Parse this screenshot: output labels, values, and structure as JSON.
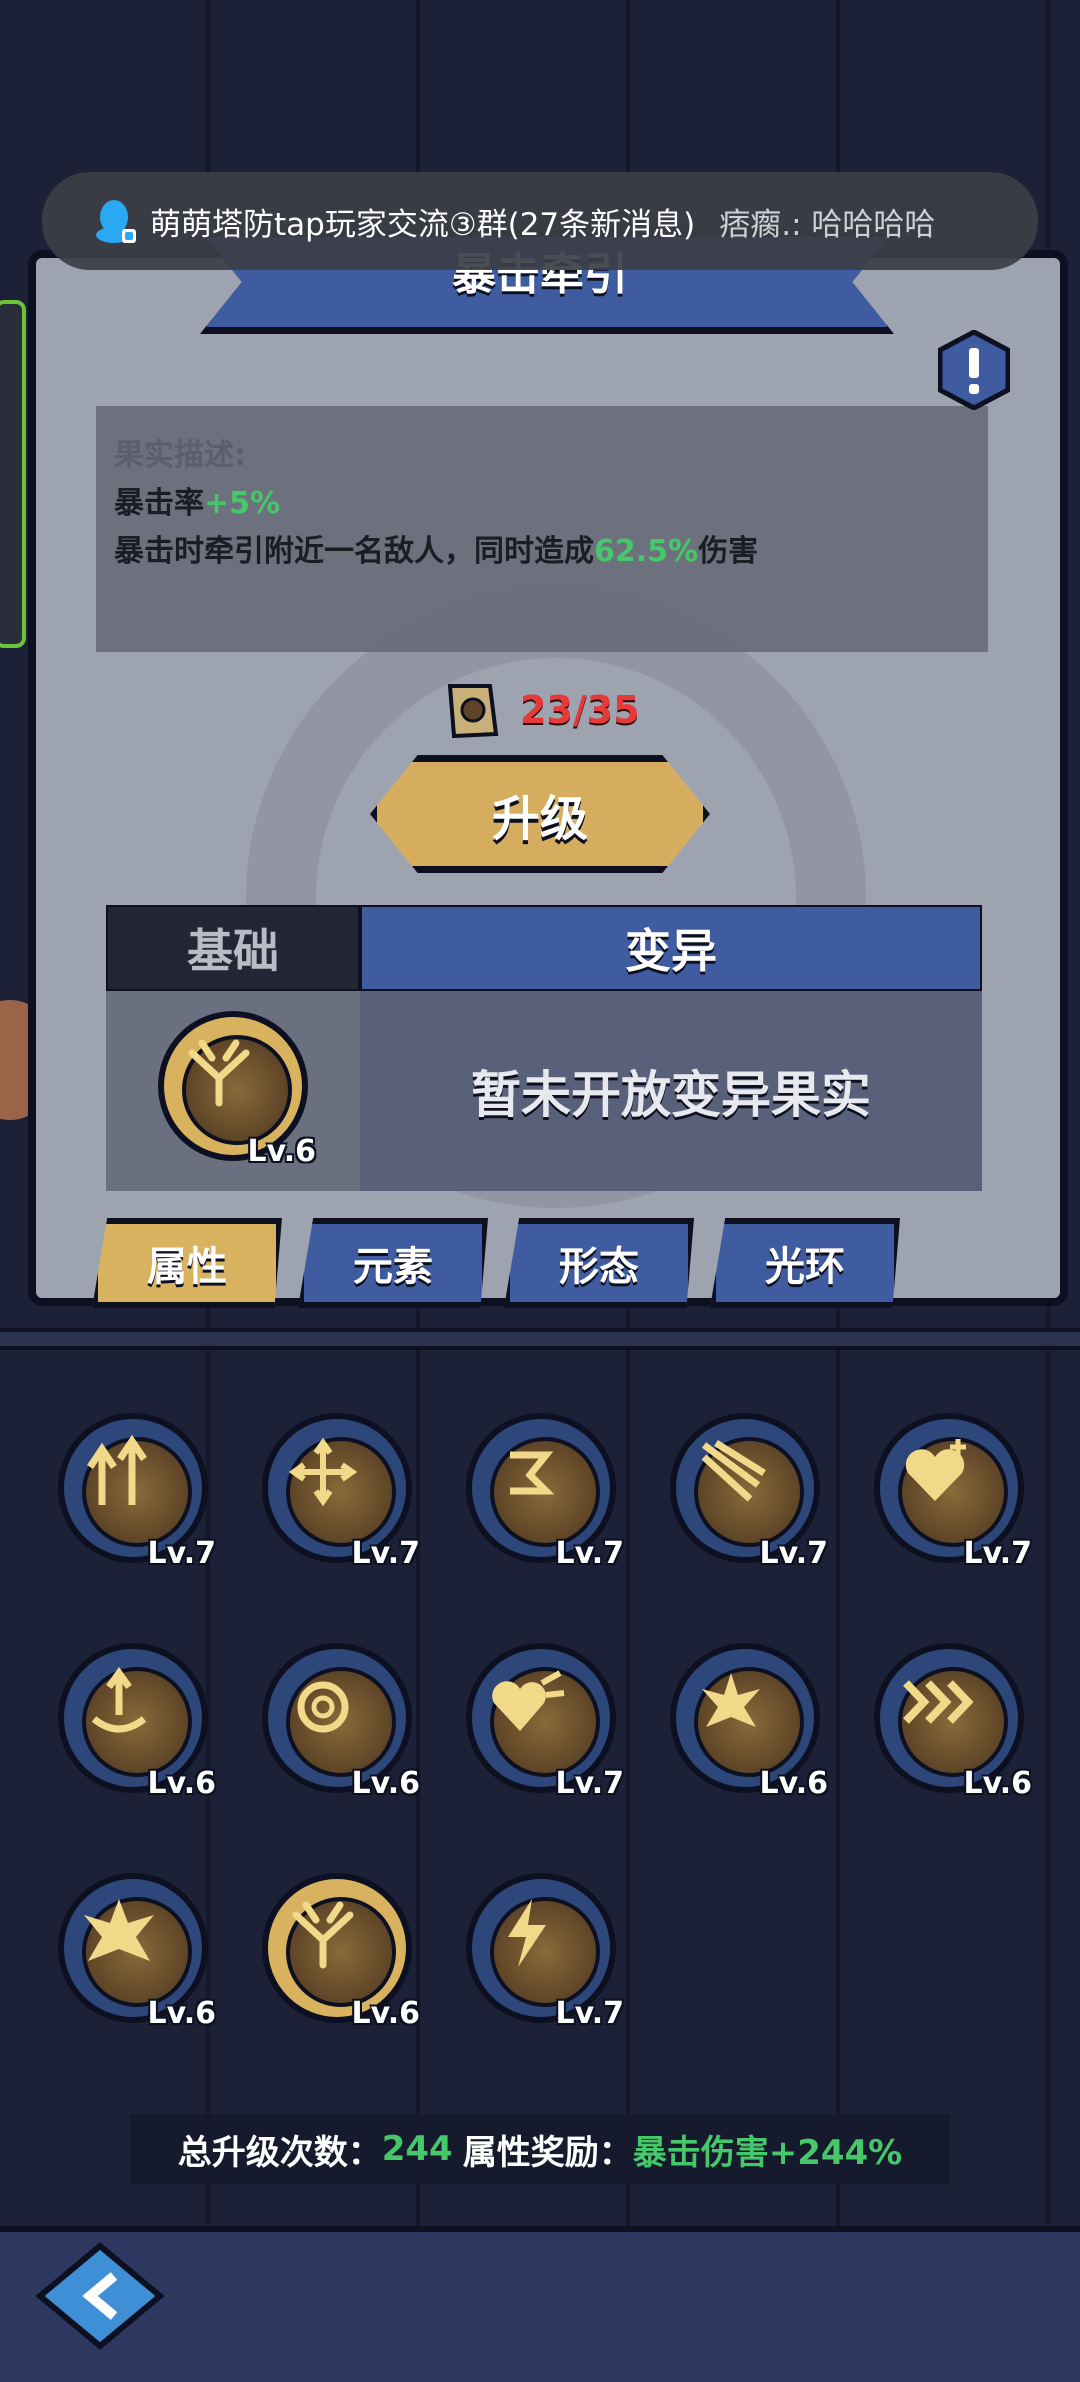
{
  "notification": {
    "title": "萌萌塔防tap玩家交流③群(27条新消息)",
    "message": "痞瘸.: 哈哈哈哈"
  },
  "panel": {
    "banner_title": "暴击牵引",
    "desc_label": "果实描述:",
    "desc_line1_a": "暴击率",
    "desc_line1_b": "+5%",
    "desc_line2_a": "暴击时牵引附近一名敌人，同时造成",
    "desc_line2_b": "62.5%",
    "desc_line2_c": "伤害",
    "cost": "23/35",
    "upgrade_label": "升级",
    "tab_base": "基础",
    "tab_mutation": "变异",
    "slot_level": "Lv.6",
    "mutation_placeholder": "暂未开放变异果实"
  },
  "categories": [
    "属性",
    "元素",
    "形态",
    "光环"
  ],
  "fruits": [
    {
      "icon": "arrows-up-icon",
      "level": "Lv.7"
    },
    {
      "icon": "arrows-out-icon",
      "level": "Lv.7"
    },
    {
      "icon": "spiral-hand-icon",
      "level": "Lv.7"
    },
    {
      "icon": "rays-icon",
      "level": "Lv.7"
    },
    {
      "icon": "heart-plus-icon",
      "level": "Lv.7"
    },
    {
      "icon": "swirl-up-icon",
      "level": "Lv.6"
    },
    {
      "icon": "pot-swirl-icon",
      "level": "Lv.6"
    },
    {
      "icon": "heart-burst-icon",
      "level": "Lv.7"
    },
    {
      "icon": "explosion-icon",
      "level": "Lv.6"
    },
    {
      "icon": "chevrons-icon",
      "level": "Lv.6"
    },
    {
      "icon": "blast-icon",
      "level": "Lv.6"
    },
    {
      "icon": "crit-pull-icon",
      "level": "Lv.6"
    },
    {
      "icon": "lightning-icon",
      "level": "Lv.7"
    }
  ],
  "summary": {
    "upgrades_label": "总升级次数：",
    "upgrades_value": "244",
    "bonus_label": "属性奖励：",
    "bonus_value": "暴击伤害+244%"
  },
  "colors": {
    "accent_blue": "#3f5ca0",
    "gold": "#d9b25f",
    "green_text": "#45c76a",
    "red_text": "#e63a3a"
  }
}
